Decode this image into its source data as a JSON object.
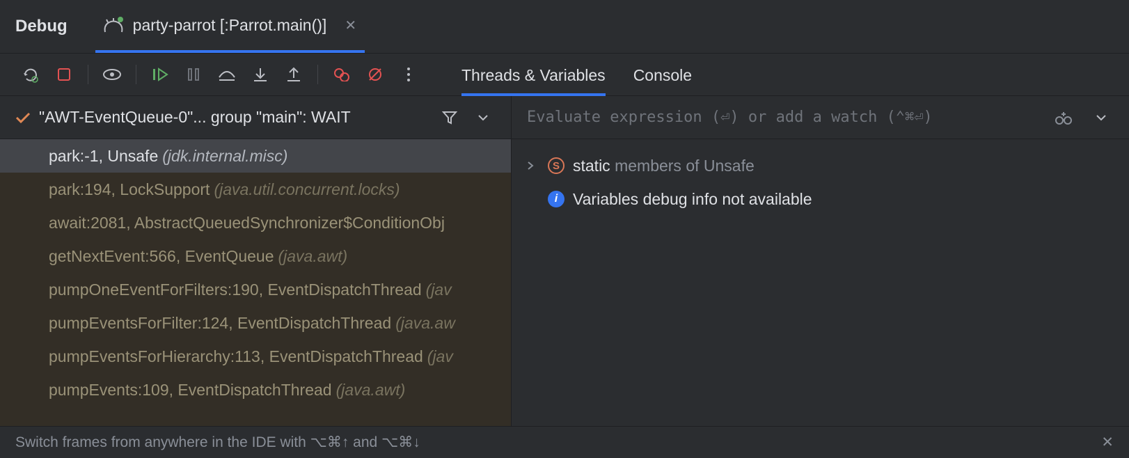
{
  "header": {
    "title": "Debug",
    "run_tab_label": "party-parrot [:Parrot.main()]"
  },
  "sub_tabs": {
    "threads_vars": "Threads & Variables",
    "console": "Console"
  },
  "thread": {
    "label": "\"AWT-EventQueue-0\"... group \"main\": WAIT"
  },
  "frames": [
    {
      "loc": "park:-1, Unsafe",
      "pkg": "(jdk.internal.misc)",
      "selected": true
    },
    {
      "loc": "park:194, LockSupport",
      "pkg": "(java.util.concurrent.locks)",
      "selected": false
    },
    {
      "loc": "await:2081, AbstractQueuedSynchronizer$ConditionObj",
      "pkg": "",
      "selected": false
    },
    {
      "loc": "getNextEvent:566, EventQueue",
      "pkg": "(java.awt)",
      "selected": false
    },
    {
      "loc": "pumpOneEventForFilters:190, EventDispatchThread",
      "pkg": "(jav",
      "selected": false
    },
    {
      "loc": "pumpEventsForFilter:124, EventDispatchThread",
      "pkg": "(java.aw",
      "selected": false
    },
    {
      "loc": "pumpEventsForHierarchy:113, EventDispatchThread",
      "pkg": "(jav",
      "selected": false
    },
    {
      "loc": "pumpEvents:109, EventDispatchThread",
      "pkg": "(java.awt)",
      "selected": false
    }
  ],
  "eval": {
    "placeholder": "Evaluate expression (⏎) or add a watch (⌃⌘⏎)"
  },
  "vars": {
    "static_label_bold": "static",
    "static_label_dim": "members of Unsafe",
    "info_msg": "Variables debug info not available"
  },
  "footer": {
    "hint": "Switch frames from anywhere in the IDE with ⌥⌘↑ and ⌥⌘↓"
  }
}
